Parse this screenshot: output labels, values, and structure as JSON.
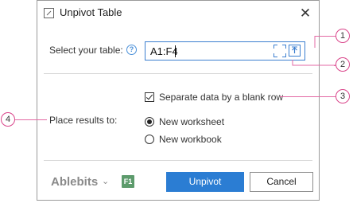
{
  "window": {
    "title": "Unpivot Table",
    "close_label": "✕"
  },
  "table_row": {
    "label": "Select your table:",
    "help_label": "?",
    "value": "A1:F4"
  },
  "options": {
    "separate_label": "Separate data by a blank row",
    "separate_checked": true
  },
  "results": {
    "label": "Place results to:",
    "choices": [
      {
        "label": "New worksheet",
        "selected": true
      },
      {
        "label": "New workbook",
        "selected": false
      }
    ]
  },
  "footer": {
    "brand": "Ablebits",
    "brand_chevron": "⌄",
    "help_key": "F1",
    "primary_label": "Unpivot",
    "cancel_label": "Cancel"
  },
  "callouts": [
    "1",
    "2",
    "3",
    "4"
  ],
  "colors": {
    "accent": "#2b7dd3",
    "callout": "#d9448a",
    "help_badge": "#5d9b6c"
  }
}
